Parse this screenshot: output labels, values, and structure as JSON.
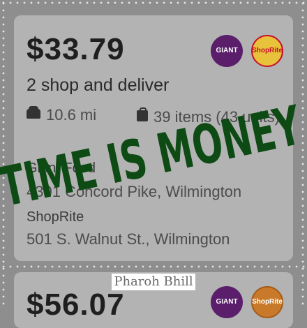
{
  "offer_1": {
    "price": "$33.79",
    "subtitle": "2 shop and deliver",
    "distance": "10.6 mi",
    "items": "39 items (43 units)",
    "stores": [
      {
        "name": "Giant Food",
        "address": "4301 Concord Pike, Wilmington",
        "logo_text": "GIANT"
      },
      {
        "name": "ShopRite",
        "address": "501 S. Walnut St., Wilmington",
        "logo_text": "ShopRite"
      }
    ]
  },
  "offer_2": {
    "price": "$56.07",
    "logos": [
      "GIANT",
      "ShopRite"
    ]
  },
  "overlay_text": "TIME IS MONEY",
  "watermark": "Pharoh Bhill",
  "colors": {
    "overlay": "#0d4a14",
    "giant": "#5a1e6b",
    "shoprite": "#e8c23a"
  }
}
